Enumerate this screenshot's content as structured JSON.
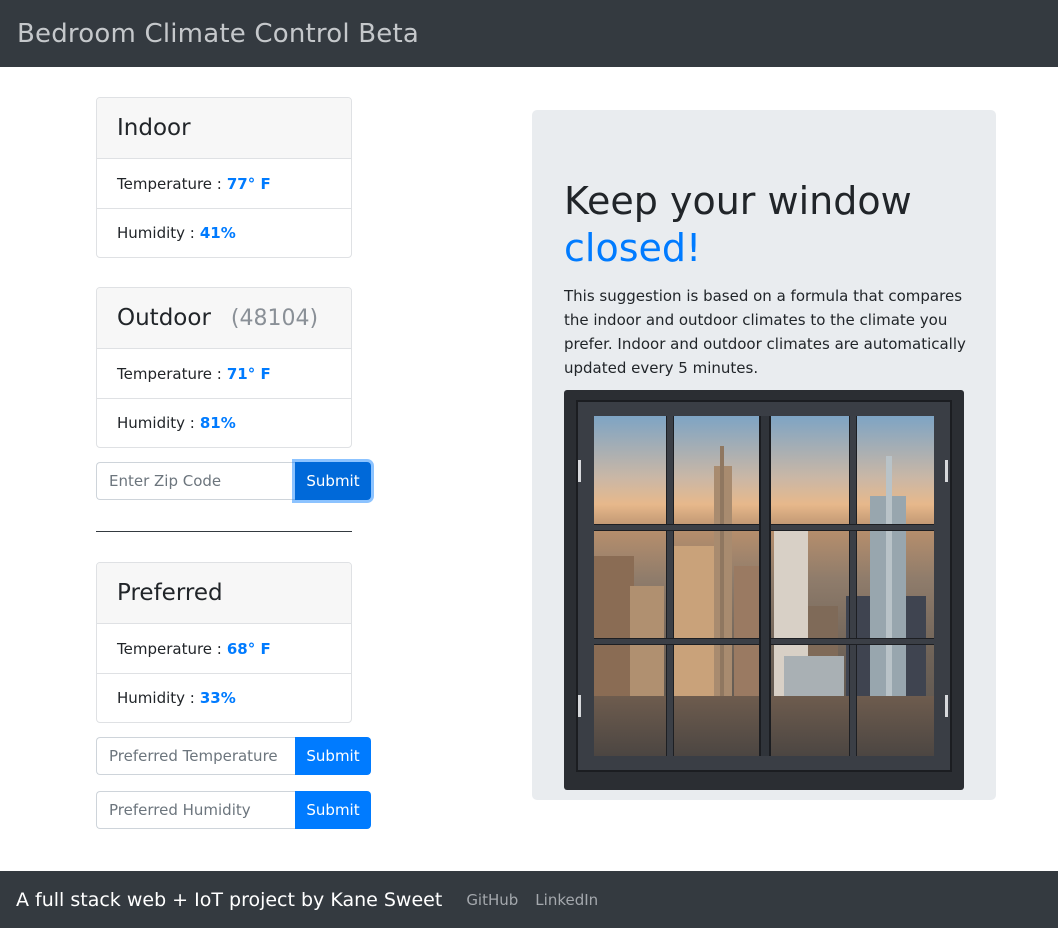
{
  "navbar": {
    "brand": "Bedroom Climate Control Beta"
  },
  "indoor": {
    "title": "Indoor",
    "temperature_label": "Temperature :",
    "temperature_value": "77° F",
    "humidity_label": "Humidity :",
    "humidity_value": "41%"
  },
  "outdoor": {
    "title": "Outdoor",
    "zip": "(48104)",
    "temperature_label": "Temperature :",
    "temperature_value": "71° F",
    "humidity_label": "Humidity :",
    "humidity_value": "81%"
  },
  "zip_form": {
    "placeholder": "Enter Zip Code",
    "submit_label": "Submit"
  },
  "preferred": {
    "title": "Preferred",
    "temperature_label": "Temperature :",
    "temperature_value": "68° F",
    "humidity_label": "Humidity :",
    "humidity_value": "33%"
  },
  "preferred_temperature_form": {
    "placeholder": "Preferred Temperature",
    "submit_label": "Submit"
  },
  "preferred_humidity_form": {
    "placeholder": "Preferred Humidity",
    "submit_label": "Submit"
  },
  "recommendation": {
    "heading": "Keep your window",
    "status": "closed!",
    "description": "This suggestion is based on a formula that compares the indoor and outdoor climates to the climate you prefer. Indoor and outdoor climates are automatically updated every 5 minutes."
  },
  "footer": {
    "credit": "A full stack web + IoT project by Kane Sweet",
    "links": [
      "GitHub",
      "LinkedIn"
    ]
  },
  "colors": {
    "navbar_bg": "#343a40",
    "accent": "#007bff",
    "jumbotron_bg": "#e9ecef"
  },
  "icons": {
    "window_image": "closed-window-image"
  }
}
